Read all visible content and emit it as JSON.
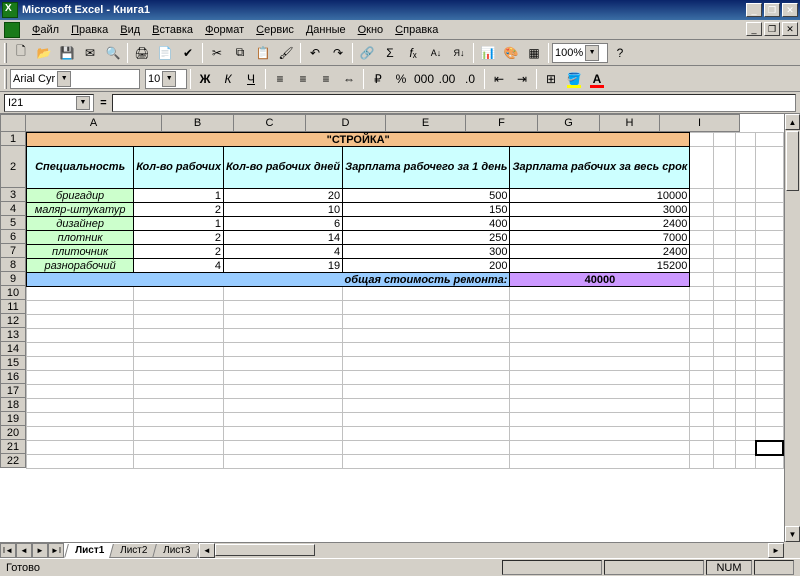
{
  "window": {
    "title": "Microsoft Excel - Книга1"
  },
  "menus": [
    "Файл",
    "Правка",
    "Вид",
    "Вставка",
    "Формат",
    "Сервис",
    "Данные",
    "Окно",
    "Справка"
  ],
  "formatbar": {
    "font": "Arial Cyr",
    "size": "10"
  },
  "zoom": "100%",
  "namebox": "I21",
  "cols": {
    "A": 136,
    "B": 72,
    "C": 72,
    "D": 80,
    "E": 80,
    "F": 72,
    "G": 62,
    "H": 60,
    "I": 80
  },
  "sheet": {
    "title": "\"СТРОЙКА\"",
    "headers": [
      "Специальность",
      "Кол-во рабочих",
      "Кол-во рабочих дней",
      "Зарплата рабочего за 1 день",
      "Зарплата рабочих за весь срок"
    ],
    "rows": [
      {
        "spec": "бригадир",
        "n": 1,
        "days": 20,
        "wage": 500,
        "total": 10000
      },
      {
        "spec": "маляр-штукатур",
        "n": 2,
        "days": 10,
        "wage": 150,
        "total": 3000
      },
      {
        "spec": "дизайнер",
        "n": 1,
        "days": 6,
        "wage": 400,
        "total": 2400
      },
      {
        "spec": "плотник",
        "n": 2,
        "days": 14,
        "wage": 250,
        "total": 7000
      },
      {
        "spec": "плиточник",
        "n": 2,
        "days": 4,
        "wage": 300,
        "total": 2400
      },
      {
        "spec": "разнорабочий",
        "n": 4,
        "days": 19,
        "wage": 200,
        "total": 15200
      }
    ],
    "total_label": "общая стоимость ремонта:",
    "grand_total": 40000
  },
  "chart_data": {
    "type": "table",
    "title": "\"СТРОЙКА\"",
    "columns": [
      "Специальность",
      "Кол-во рабочих",
      "Кол-во рабочих дней",
      "Зарплата рабочего за 1 день",
      "Зарплата рабочих за весь срок"
    ],
    "rows": [
      [
        "бригадир",
        1,
        20,
        500,
        10000
      ],
      [
        "маляр-штукатур",
        2,
        10,
        150,
        3000
      ],
      [
        "дизайнер",
        1,
        6,
        400,
        2400
      ],
      [
        "плотник",
        2,
        14,
        250,
        7000
      ],
      [
        "плиточник",
        2,
        4,
        300,
        2400
      ],
      [
        "разнорабочий",
        4,
        19,
        200,
        15200
      ]
    ],
    "summary": {
      "label": "общая стоимость ремонта:",
      "value": 40000
    }
  },
  "tabs": [
    "Лист1",
    "Лист2",
    "Лист3"
  ],
  "status": {
    "ready": "Готово",
    "num": "NUM"
  }
}
